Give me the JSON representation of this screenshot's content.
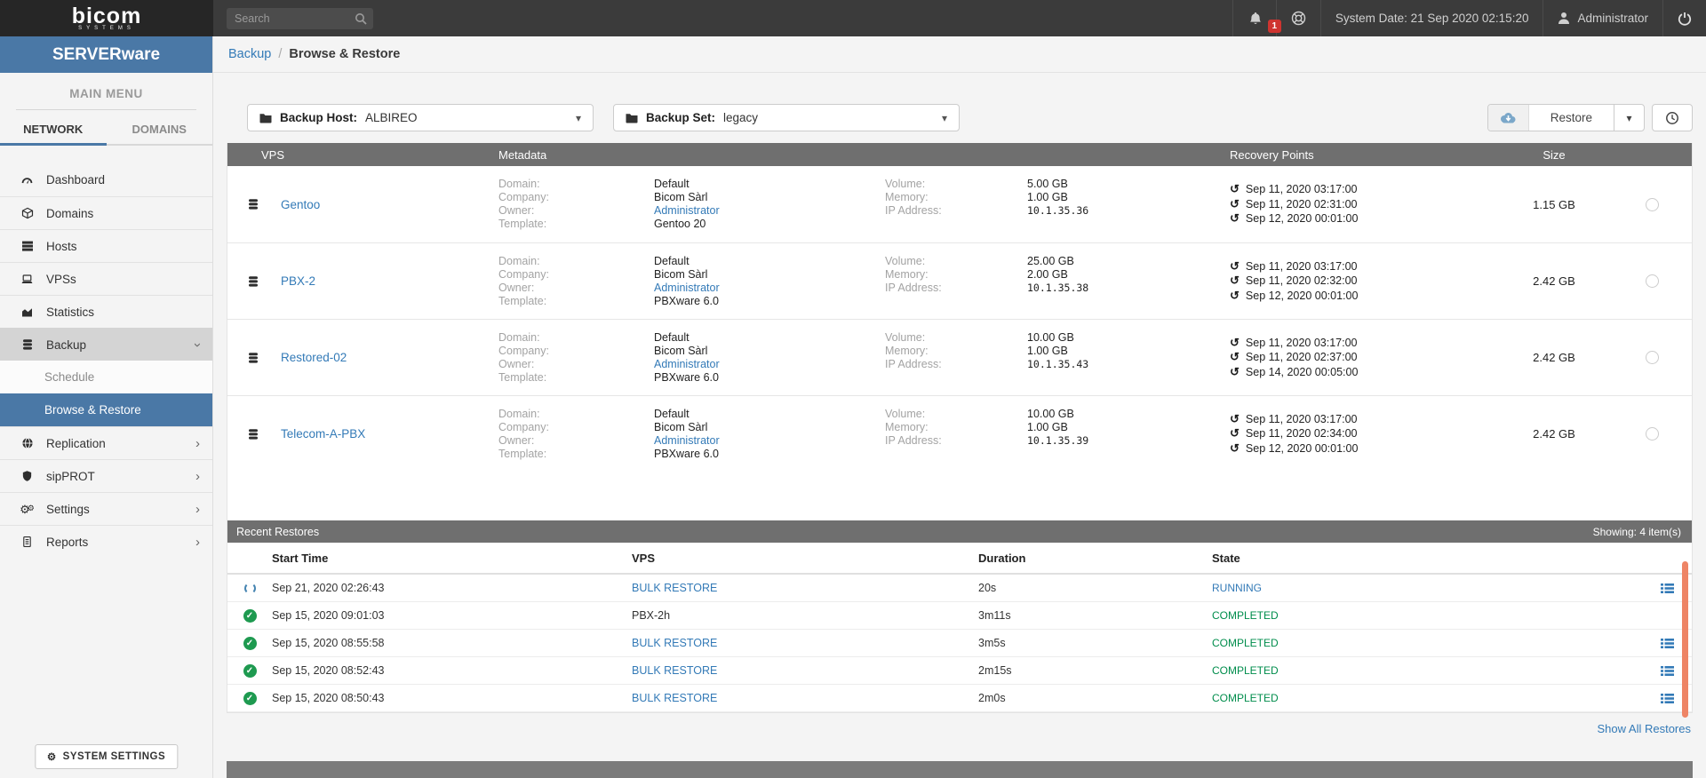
{
  "topbar": {
    "logo": "bicom",
    "logo_sub": "SYSTEMS",
    "search_placeholder": "Search",
    "notification_count": "1",
    "system_date": "System Date: 21 Sep 2020 02:15:20",
    "user": "Administrator"
  },
  "sidebar": {
    "brand": "SERVERware",
    "menu_header": "MAIN MENU",
    "tabs": [
      {
        "label": "NETWORK",
        "active": true
      },
      {
        "label": "DOMAINS",
        "active": false
      }
    ],
    "items": [
      {
        "id": "dashboard",
        "icon": "dashboard-icon",
        "label": "Dashboard"
      },
      {
        "id": "domains",
        "icon": "cube-icon",
        "label": "Domains"
      },
      {
        "id": "hosts",
        "icon": "server-icon",
        "label": "Hosts"
      },
      {
        "id": "vpss",
        "icon": "laptop-icon",
        "label": "VPSs"
      },
      {
        "id": "statistics",
        "icon": "chart-icon",
        "label": "Statistics"
      },
      {
        "id": "backup",
        "icon": "database-icon",
        "label": "Backup",
        "chevron": "down",
        "expanded": true
      },
      {
        "id": "schedule",
        "label": "Schedule",
        "sub": true
      },
      {
        "id": "browse-restore",
        "label": "Browse & Restore",
        "sub": true,
        "selected": true
      },
      {
        "id": "replication",
        "icon": "globe-icon",
        "label": "Replication",
        "chevron": "right"
      },
      {
        "id": "sipprot",
        "icon": "shield-icon",
        "label": "sipPROT",
        "chevron": "right"
      },
      {
        "id": "settings",
        "icon": "gears-icon",
        "label": "Settings",
        "chevron": "right"
      },
      {
        "id": "reports",
        "icon": "report-icon",
        "label": "Reports",
        "chevron": "right"
      }
    ],
    "system_settings_label": "SYSTEM SETTINGS"
  },
  "breadcrumb": {
    "parent": "Backup",
    "separator": "/",
    "current": "Browse & Restore"
  },
  "toolbar": {
    "backup_host_label": "Backup Host:",
    "backup_host_value": "ALBIREO",
    "backup_set_label": "Backup Set:",
    "backup_set_value": "legacy",
    "restore_label": "Restore"
  },
  "vps_table": {
    "columns": [
      "VPS",
      "Metadata",
      "Recovery Points",
      "Size"
    ],
    "meta_labels": {
      "domain": "Domain:",
      "company": "Company:",
      "owner": "Owner:",
      "template": "Template:",
      "volume": "Volume:",
      "memory": "Memory:",
      "ip": "IP Address:"
    },
    "rows": [
      {
        "name": "Gentoo",
        "domain": "Default",
        "company": "Bicom Sàrl",
        "owner": "Administrator",
        "template": "Gentoo 20",
        "volume": "5.00 GB",
        "memory": "1.00 GB",
        "ip": "10.1.35.36",
        "recovery_points": [
          "Sep 11, 2020 03:17:00",
          "Sep 11, 2020 02:31:00",
          "Sep 12, 2020 00:01:00"
        ],
        "size": "1.15 GB"
      },
      {
        "name": "PBX-2",
        "domain": "Default",
        "company": "Bicom Sàrl",
        "owner": "Administrator",
        "template": "PBXware 6.0",
        "volume": "25.00 GB",
        "memory": "2.00 GB",
        "ip": "10.1.35.38",
        "recovery_points": [
          "Sep 11, 2020 03:17:00",
          "Sep 11, 2020 02:32:00",
          "Sep 12, 2020 00:01:00"
        ],
        "size": "2.42 GB"
      },
      {
        "name": "Restored-02",
        "domain": "Default",
        "company": "Bicom Sàrl",
        "owner": "Administrator",
        "template": "PBXware 6.0",
        "volume": "10.00 GB",
        "memory": "1.00 GB",
        "ip": "10.1.35.43",
        "recovery_points": [
          "Sep 11, 2020 03:17:00",
          "Sep 11, 2020 02:37:00",
          "Sep 14, 2020 00:05:00"
        ],
        "size": "2.42 GB"
      },
      {
        "name": "Telecom-A-PBX",
        "domain": "Default",
        "company": "Bicom Sàrl",
        "owner": "Administrator",
        "template": "PBXware 6.0",
        "volume": "10.00 GB",
        "memory": "1.00 GB",
        "ip": "10.1.35.39",
        "recovery_points": [
          "Sep 11, 2020 03:17:00",
          "Sep 11, 2020 02:34:00",
          "Sep 12, 2020 00:01:00"
        ],
        "size": "2.42 GB"
      }
    ]
  },
  "recent_restores": {
    "title": "Recent Restores",
    "showing": "Showing: 4 item(s)",
    "columns": [
      "Start Time",
      "VPS",
      "Duration",
      "State"
    ],
    "rows": [
      {
        "status": "running",
        "start_time": "Sep 21, 2020 02:26:43",
        "vps": "BULK RESTORE",
        "vps_is_link": true,
        "duration": "20s",
        "state": "RUNNING",
        "has_details": true
      },
      {
        "status": "completed",
        "start_time": "Sep 15, 2020 09:01:03",
        "vps": "PBX-2h",
        "vps_is_link": false,
        "duration": "3m11s",
        "state": "COMPLETED",
        "has_details": false
      },
      {
        "status": "completed",
        "start_time": "Sep 15, 2020 08:55:58",
        "vps": "BULK RESTORE",
        "vps_is_link": true,
        "duration": "3m5s",
        "state": "COMPLETED",
        "has_details": true
      },
      {
        "status": "completed",
        "start_time": "Sep 15, 2020 08:52:43",
        "vps": "BULK RESTORE",
        "vps_is_link": true,
        "duration": "2m15s",
        "state": "COMPLETED",
        "has_details": true
      },
      {
        "status": "completed",
        "start_time": "Sep 15, 2020 08:50:43",
        "vps": "BULK RESTORE",
        "vps_is_link": true,
        "duration": "2m0s",
        "state": "COMPLETED",
        "has_details": true
      }
    ],
    "show_all_label": "Show All Restores"
  },
  "colors": {
    "accent_blue": "#4a78a6",
    "link_blue": "#337ab7",
    "table_header_gray": "#6f6f6f",
    "running_blue": "#337ab7",
    "completed_green": "#008d4c",
    "badge_red": "#cf3430",
    "scrollbar_orange": "#ee8465"
  }
}
